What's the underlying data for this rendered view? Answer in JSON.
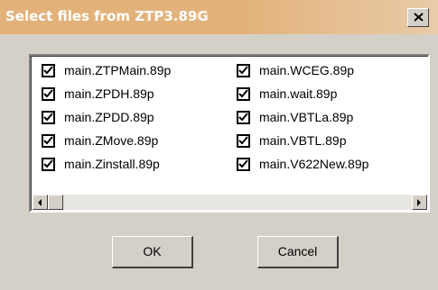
{
  "window": {
    "title": "Select files from ZTP3.89G",
    "close_icon": "close-icon"
  },
  "files": {
    "column1": [
      {
        "label": "main.ZTPMain.89p",
        "checked": true
      },
      {
        "label": "main.ZPDH.89p",
        "checked": true
      },
      {
        "label": "main.ZPDD.89p",
        "checked": true
      },
      {
        "label": "main.ZMove.89p",
        "checked": true
      },
      {
        "label": "main.Zinstall.89p",
        "checked": true
      }
    ],
    "column2": [
      {
        "label": "main.WCEG.89p",
        "checked": true
      },
      {
        "label": "main.wait.89p",
        "checked": true
      },
      {
        "label": "main.VBTLa.89p",
        "checked": true
      },
      {
        "label": "main.VBTL.89p",
        "checked": true
      },
      {
        "label": "main.V622New.89p",
        "checked": true
      }
    ]
  },
  "buttons": {
    "ok_label": "OK",
    "cancel_label": "Cancel"
  },
  "colors": {
    "title_bar": "#e3b27a",
    "dialog_face": "#d4d0c8"
  }
}
